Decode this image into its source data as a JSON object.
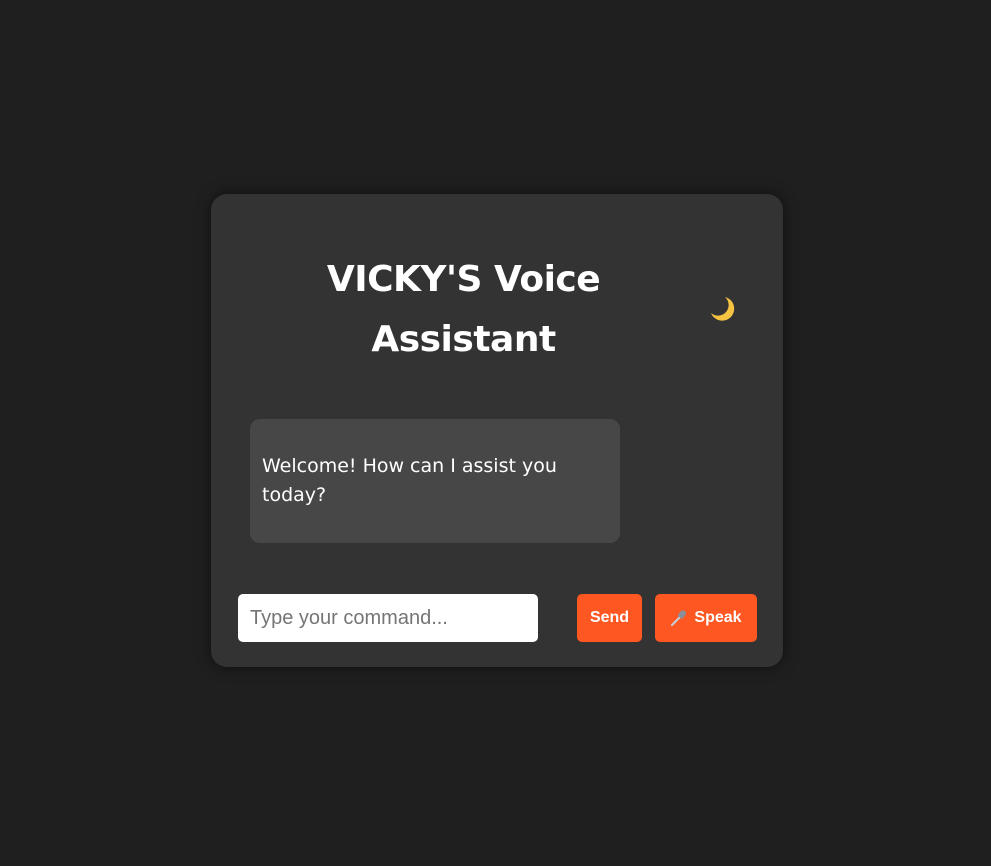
{
  "app": {
    "title": "VICKY'S Voice Assistant"
  },
  "theme_toggle": {
    "icon": "moon-icon",
    "color": "#f5c242"
  },
  "chat": {
    "messages": [
      {
        "text": "Welcome! How can I assist you today?"
      }
    ]
  },
  "input": {
    "placeholder": "Type your command...",
    "value": ""
  },
  "buttons": {
    "send_label": "Send",
    "speak_label": "Speak",
    "speak_icon": "microphone-icon"
  },
  "colors": {
    "background": "#1f1f1f",
    "card": "#333333",
    "bubble": "#474747",
    "accent": "#ff5722"
  }
}
